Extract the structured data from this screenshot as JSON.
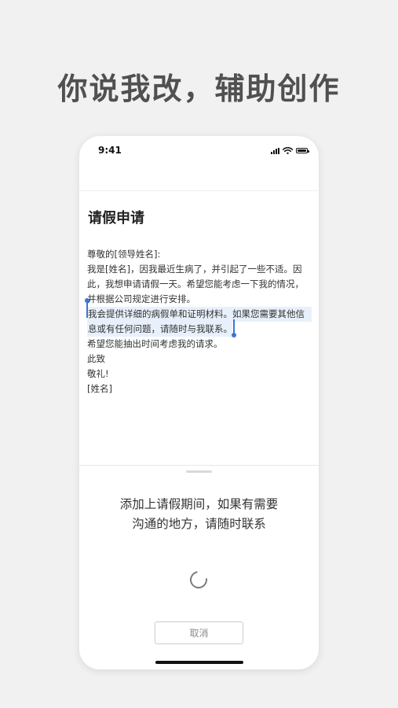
{
  "headline": "你说我改，辅助创作",
  "status_bar": {
    "time": "9:41"
  },
  "document": {
    "title": "请假申请",
    "lines": [
      "尊敬的[领导姓名]:",
      "我是[姓名]，因我最近生病了，并引起了一些不适。因",
      "此，我想申请请假一天。希望您能考虑一下我的情况，",
      "并根据公司规定进行安排。",
      "我会提供详细的病假单和证明材料。如果您需要其他信",
      "息或有任何问题，请随时与我联系。",
      "希望您能抽出时间考虑我的请求。",
      "此致",
      "敬礼!",
      "[姓名]"
    ]
  },
  "assistant": {
    "prompt_line1": "添加上请假期间，如果有需要",
    "prompt_line2": "沟通的地方，请随时联系",
    "cancel_label": "取消"
  },
  "colors": {
    "selection": "#e8f1fb",
    "handle": "#3d74d8"
  }
}
